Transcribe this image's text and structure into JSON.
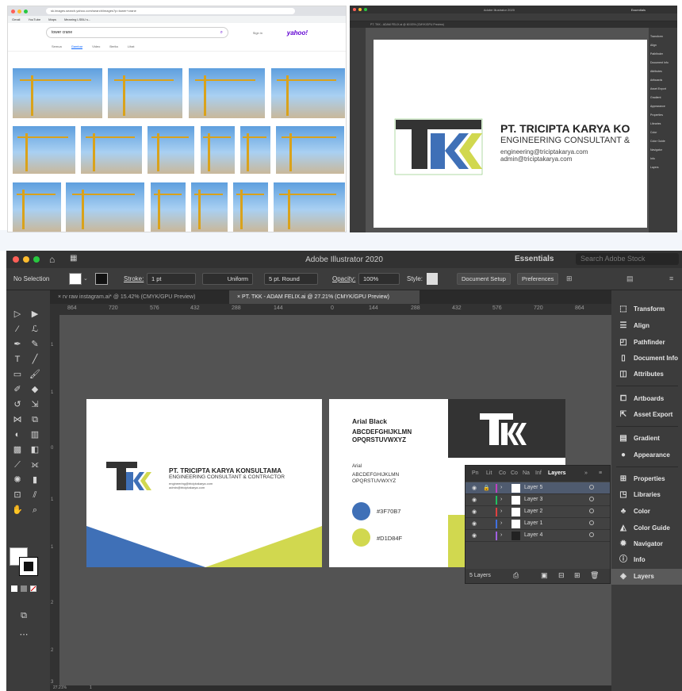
{
  "browser": {
    "url": "sk.images.search.yahoo.com/search/images?p=tower+crane",
    "bookmarks": [
      "Gmail",
      "YouTube",
      "Maps",
      "Meaning LSBU s..."
    ],
    "search_value": "tower crane",
    "brand": "yahoo!",
    "signin": "Sign in",
    "tabs": [
      "Semua",
      "Gambar",
      "Video",
      "Berita",
      "Lihat"
    ]
  },
  "mini_app": {
    "app_title": "Adobe Illustrator 2020",
    "workspace": "Essentials",
    "tab": "PT. TKK - ADAM FELIX.ai @ 60.53% (CMYK/GPU Preview)",
    "company_name": "PT. TRICIPTA KARYA KO",
    "company_tagline": "ENGINEERING CONSULTANT &",
    "email1": "engineering@triciptakarya.com",
    "email2": "admin@triciptakarya.com",
    "panel_items": [
      "Transform",
      "Align",
      "Pathfinder",
      "Document Info",
      "Attributes",
      "Artboards",
      "Asset Export",
      "Gradient",
      "Appearance",
      "Properties",
      "Libraries",
      "Color",
      "Color Guide",
      "Navigator",
      "Info",
      "Layers"
    ]
  },
  "app": {
    "title": "Adobe Illustrator 2020",
    "workspace": "Essentials",
    "search_placeholder": "Search Adobe Stock",
    "control": {
      "selection": "No Selection",
      "stroke_label": "Stroke:",
      "stroke_value": "1 pt",
      "stroke_profile": "Uniform",
      "brush": "5 pt. Round",
      "opacity_label": "Opacity:",
      "opacity_value": "100%",
      "style_label": "Style:",
      "doc_setup": "Document Setup",
      "preferences": "Preferences"
    },
    "tabs": [
      {
        "label": "rv raw instagram.ai* @ 15.42% (CMYK/GPU Preview)"
      },
      {
        "label": "PT. TKK - ADAM FELIX.ai @ 27.21% (CMYK/GPU Preview)"
      }
    ],
    "ruler_ticks": [
      "864",
      "720",
      "576",
      "432",
      "288",
      "144",
      "0",
      "144",
      "288",
      "432",
      "576",
      "720",
      "864"
    ],
    "vruler_ticks": [
      "1",
      "1",
      "0",
      "1",
      "1",
      "2",
      "2",
      "3"
    ],
    "right_panel": [
      "Transform",
      "Align",
      "Pathfinder",
      "Document Info",
      "Attributes",
      "Artboards",
      "Asset Export",
      "Gradient",
      "Appearance",
      "Properties",
      "Libraries",
      "Color",
      "Color Guide",
      "Navigator",
      "Info",
      "Layers"
    ],
    "status_zoom": "27.21%",
    "status_page": "1"
  },
  "card_front": {
    "logo_text": "TKK",
    "company_name": "PT. TRICIPTA KARYA KONSULTAMA",
    "company_tagline": "ENGINEERING CONSULTANT & CONTRACTOR",
    "email1": "engineering@triciptakarya.com",
    "email2": "admin@triciptakarya.com"
  },
  "card_back": {
    "font1_name": "Arial Black",
    "font1_upper1": "ABCDEFGHIJKLMN",
    "font1_upper2": "OPQRSTUVWXYZ",
    "font2_name": "Arial",
    "font2_upper1": "ABCDEFGHIJKLMN",
    "font2_upper2": "OPQRSTUVWXYZ",
    "color1_hex": "#3F70B7",
    "color2_hex": "#D1D84F"
  },
  "colors": {
    "blue": "#3F70B7",
    "green": "#D1D84F",
    "dark": "#333333"
  },
  "layers_panel": {
    "tabs": [
      "Pn",
      "Lit",
      "Co",
      "Co",
      "Na",
      "Inf",
      "Layers"
    ],
    "layers": [
      {
        "name": "Layer 5",
        "color": "#c040c0"
      },
      {
        "name": "Layer 3",
        "color": "#20c060"
      },
      {
        "name": "Layer 2",
        "color": "#e04040"
      },
      {
        "name": "Layer 1",
        "color": "#4070e0"
      },
      {
        "name": "Layer 4",
        "color": "#a060e0"
      }
    ],
    "count": "5 Layers"
  }
}
